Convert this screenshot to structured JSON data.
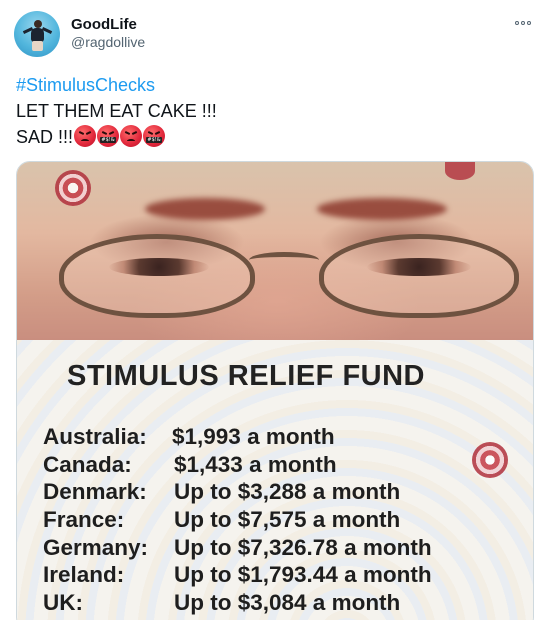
{
  "tweet": {
    "display_name": "GoodLife",
    "handle": "@ragdollive",
    "hashtag": "#StimulusChecks",
    "line2": "LET THEM EAT CAKE !!!",
    "line3": "SAD !!!",
    "emojis": [
      "enraged-face",
      "face-with-symbols-on-mouth",
      "enraged-face",
      "face-with-symbols-on-mouth"
    ]
  },
  "image": {
    "sign_title": "STIMULUS RELIEF FUND",
    "rows": [
      {
        "country": "Australia:",
        "amount": "$1,993 a month"
      },
      {
        "country": "Canada:",
        "amount": "$1,433 a month"
      },
      {
        "country": "Denmark:",
        "amount": "Up to $3,288 a month"
      },
      {
        "country": "France:",
        "amount": "Up to $7,575 a month"
      },
      {
        "country": "Germany:",
        "amount": "Up to $7,326.78 a month"
      },
      {
        "country": "Ireland:",
        "amount": "Up to $1,793.44 a month"
      },
      {
        "country": "UK:",
        "amount": "Up to $3,084 a month"
      }
    ]
  },
  "colors": {
    "link": "#1d9bf0",
    "text": "#0f1419",
    "secondary": "#536471"
  }
}
